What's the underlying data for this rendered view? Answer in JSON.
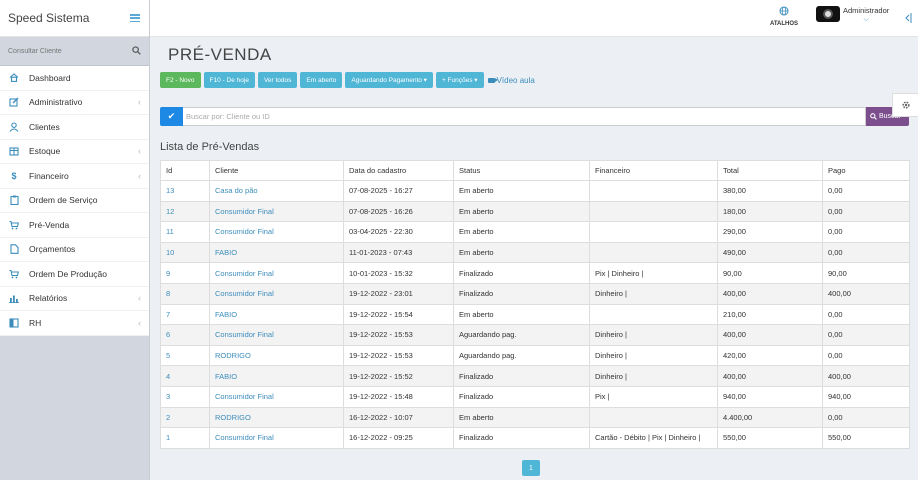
{
  "sidebar": {
    "brand": "Speed Sistema",
    "search_placeholder": "Consultar Cliente",
    "items": [
      {
        "label": "Dashboard",
        "icon": "home-icon",
        "has_caret": false
      },
      {
        "label": "Administrativo",
        "icon": "edit-icon",
        "has_caret": true
      },
      {
        "label": "Clientes",
        "icon": "user-icon",
        "has_caret": false
      },
      {
        "label": "Estoque",
        "icon": "box-icon",
        "has_caret": true
      },
      {
        "label": "Financeiro",
        "icon": "dollar-icon",
        "has_caret": true
      },
      {
        "label": "Ordem de Serviço",
        "icon": "clipboard-icon",
        "has_caret": false
      },
      {
        "label": "Pré-Venda",
        "icon": "cart-icon",
        "has_caret": false
      },
      {
        "label": "Orçamentos",
        "icon": "file-icon",
        "has_caret": false
      },
      {
        "label": "Ordem De Produção",
        "icon": "cart-icon",
        "has_caret": false
      },
      {
        "label": "Relatórios",
        "icon": "bar-chart-icon",
        "has_caret": true
      },
      {
        "label": "RH",
        "icon": "book-icon",
        "has_caret": true
      }
    ]
  },
  "topbar": {
    "shortcuts_label": "ATALHOS",
    "user_name": "Administrador"
  },
  "page": {
    "title": "PRÉ-VENDA",
    "buttons": {
      "new": "F2 - Novo",
      "today": "F10 - De hoje",
      "all": "Ver todos",
      "open": "Em aberto",
      "awaiting": "Aguardando Pagamento ▾",
      "functions": "+ Funções ▾"
    },
    "video_link": "Vídeo aula",
    "search_placeholder": "Buscar por: Cliente ou ID",
    "search_button": "Buscar",
    "list_title": "Lista de Pré-Vendas",
    "pager_label": "1"
  },
  "table": {
    "columns": [
      "Id",
      "Cliente",
      "Data do cadastro",
      "Status",
      "Financeiro",
      "Total",
      "Pago"
    ],
    "rows": [
      [
        "13",
        "Casa do pão",
        "07-08-2025 - 16:27",
        "Em aberto",
        "",
        "380,00",
        "0,00"
      ],
      [
        "12",
        "Consumidor Final",
        "07-08-2025 - 16:26",
        "Em aberto",
        "",
        "180,00",
        "0,00"
      ],
      [
        "11",
        "Consumidor Final",
        "03-04-2025 - 22:30",
        "Em aberto",
        "",
        "290,00",
        "0,00"
      ],
      [
        "10",
        "FABIO",
        "11-01-2023 - 07:43",
        "Em aberto",
        "",
        "490,00",
        "0,00"
      ],
      [
        "9",
        "Consumidor Final",
        "10-01-2023 - 15:32",
        "Finalizado",
        "Pix | Dinheiro |",
        "90,00",
        "90,00"
      ],
      [
        "8",
        "Consumidor Final",
        "19-12-2022 - 23:01",
        "Finalizado",
        "Dinheiro |",
        "400,00",
        "400,00"
      ],
      [
        "7",
        "FABIO",
        "19-12-2022 - 15:54",
        "Em aberto",
        "",
        "210,00",
        "0,00"
      ],
      [
        "6",
        "Consumidor Final",
        "19-12-2022 - 15:53",
        "Aguardando pag.",
        "Dinheiro |",
        "400,00",
        "0,00"
      ],
      [
        "5",
        "RODRIGO",
        "19-12-2022 - 15:53",
        "Aguardando pag.",
        "Dinheiro |",
        "420,00",
        "0,00"
      ],
      [
        "4",
        "FABIO",
        "19-12-2022 - 15:52",
        "Finalizado",
        "Dinheiro |",
        "400,00",
        "400,00"
      ],
      [
        "3",
        "Consumidor Final",
        "19-12-2022 - 15:48",
        "Finalizado",
        "Pix |",
        "940,00",
        "940,00"
      ],
      [
        "2",
        "RODRIGO",
        "16-12-2022 - 10:07",
        "Em aberto",
        "",
        "4.400,00",
        "0,00"
      ],
      [
        "1",
        "Consumidor Final",
        "16-12-2022 - 09:25",
        "Finalizado",
        "Cartão - Débito | Pix | Dinheiro |",
        "550,00",
        "550,00"
      ]
    ]
  },
  "colors": {
    "accent": "#3c8dbc",
    "green": "#5cb85c",
    "info": "#4fb6d6",
    "search_check": "#1e88e5",
    "search_button": "#7d4e8d"
  }
}
